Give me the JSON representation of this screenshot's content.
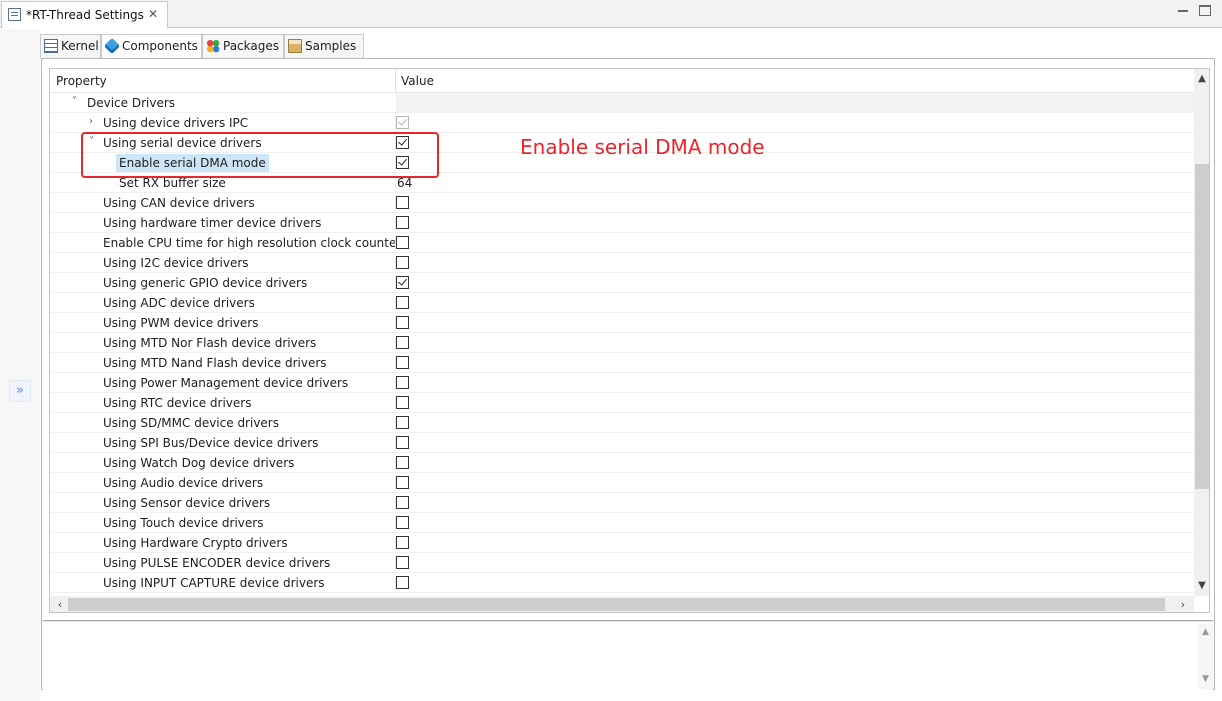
{
  "editor_tab": {
    "title": "*RT-Thread Settings",
    "close_glyph": "✕"
  },
  "subtabs": [
    {
      "label": "Kernel",
      "icon": "kernel-icon"
    },
    {
      "label": "Components",
      "icon": "components-icon"
    },
    {
      "label": "Packages",
      "icon": "packages-icon"
    },
    {
      "label": "Samples",
      "icon": "samples-icon"
    }
  ],
  "trim": {
    "show_glyph": "»"
  },
  "table": {
    "header_property": "Property",
    "header_value": "Value",
    "rows": [
      {
        "label": "Device Drivers",
        "toggle": "˅",
        "value": ""
      },
      {
        "label": "Using device drivers IPC",
        "toggle": "›",
        "value": "checked-disabled"
      },
      {
        "label": "Using serial device drivers",
        "toggle": "˅",
        "value": "checked"
      },
      {
        "label": "Enable serial DMA mode",
        "value": "checked"
      },
      {
        "label": "Set RX buffer size",
        "value": "64"
      },
      {
        "label": "Using CAN device drivers",
        "value": "unchecked"
      },
      {
        "label": "Using hardware timer device drivers",
        "value": "unchecked"
      },
      {
        "label": "Enable CPU time for high resolution clock counter",
        "value": "unchecked"
      },
      {
        "label": "Using I2C device drivers",
        "value": "unchecked"
      },
      {
        "label": "Using generic GPIO device drivers",
        "value": "checked"
      },
      {
        "label": "Using ADC device drivers",
        "value": "unchecked"
      },
      {
        "label": "Using PWM device drivers",
        "value": "unchecked"
      },
      {
        "label": "Using MTD Nor Flash device drivers",
        "value": "unchecked"
      },
      {
        "label": "Using MTD Nand Flash device drivers",
        "value": "unchecked"
      },
      {
        "label": "Using Power Management device drivers",
        "value": "unchecked"
      },
      {
        "label": "Using RTC device drivers",
        "value": "unchecked"
      },
      {
        "label": "Using SD/MMC device drivers",
        "value": "unchecked"
      },
      {
        "label": "Using SPI Bus/Device device drivers",
        "value": "unchecked"
      },
      {
        "label": "Using Watch Dog device drivers",
        "value": "unchecked"
      },
      {
        "label": "Using Audio device drivers",
        "value": "unchecked"
      },
      {
        "label": "Using Sensor device drivers",
        "value": "unchecked"
      },
      {
        "label": "Using Touch device drivers",
        "value": "unchecked"
      },
      {
        "label": "Using Hardware Crypto drivers",
        "value": "unchecked"
      },
      {
        "label": "Using PULSE ENCODER device drivers",
        "value": "unchecked"
      },
      {
        "label": "Using INPUT CAPTURE device drivers",
        "value": "unchecked"
      }
    ]
  },
  "annotation": {
    "text": "Enable serial DMA mode",
    "color": "#e8262b"
  },
  "colors": {
    "selection": "#cce5f7",
    "accent": "#3aa0e6"
  }
}
